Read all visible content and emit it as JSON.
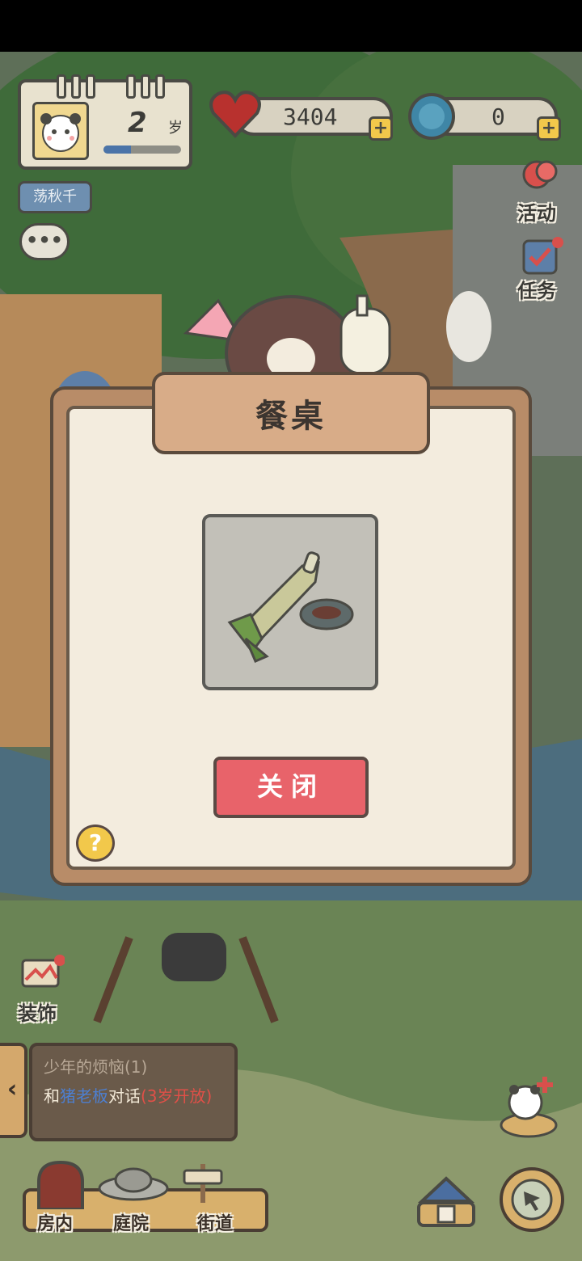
{
  "hud": {
    "age_value": "2",
    "age_unit": "岁",
    "age_progress": 0.35,
    "status_tag": "荡秋千",
    "chat_icon_text": "•••",
    "hearts_value": "3404",
    "gems_value": "0",
    "plus_symbol": "+"
  },
  "side": {
    "activity_label": "活动",
    "task_label": "任务",
    "decorate_label": "装饰"
  },
  "dialog": {
    "title": "餐桌",
    "close_label": "关闭",
    "help_symbol": "?"
  },
  "quest": {
    "arrow": "‹",
    "title": "少年的烦恼(1)",
    "body_prefix": "和",
    "body_npc": "猪老板",
    "body_action": "对话",
    "body_unlock": "(3岁开放)"
  },
  "nav": {
    "room": "房内",
    "yard": "庭院",
    "street": "街道"
  },
  "colors": {
    "close_button": "#e8636a",
    "npc_name": "#4d7fd0",
    "unlock_text": "#e05048",
    "plus_button": "#f2c84b",
    "help_button": "#f2c84b"
  }
}
